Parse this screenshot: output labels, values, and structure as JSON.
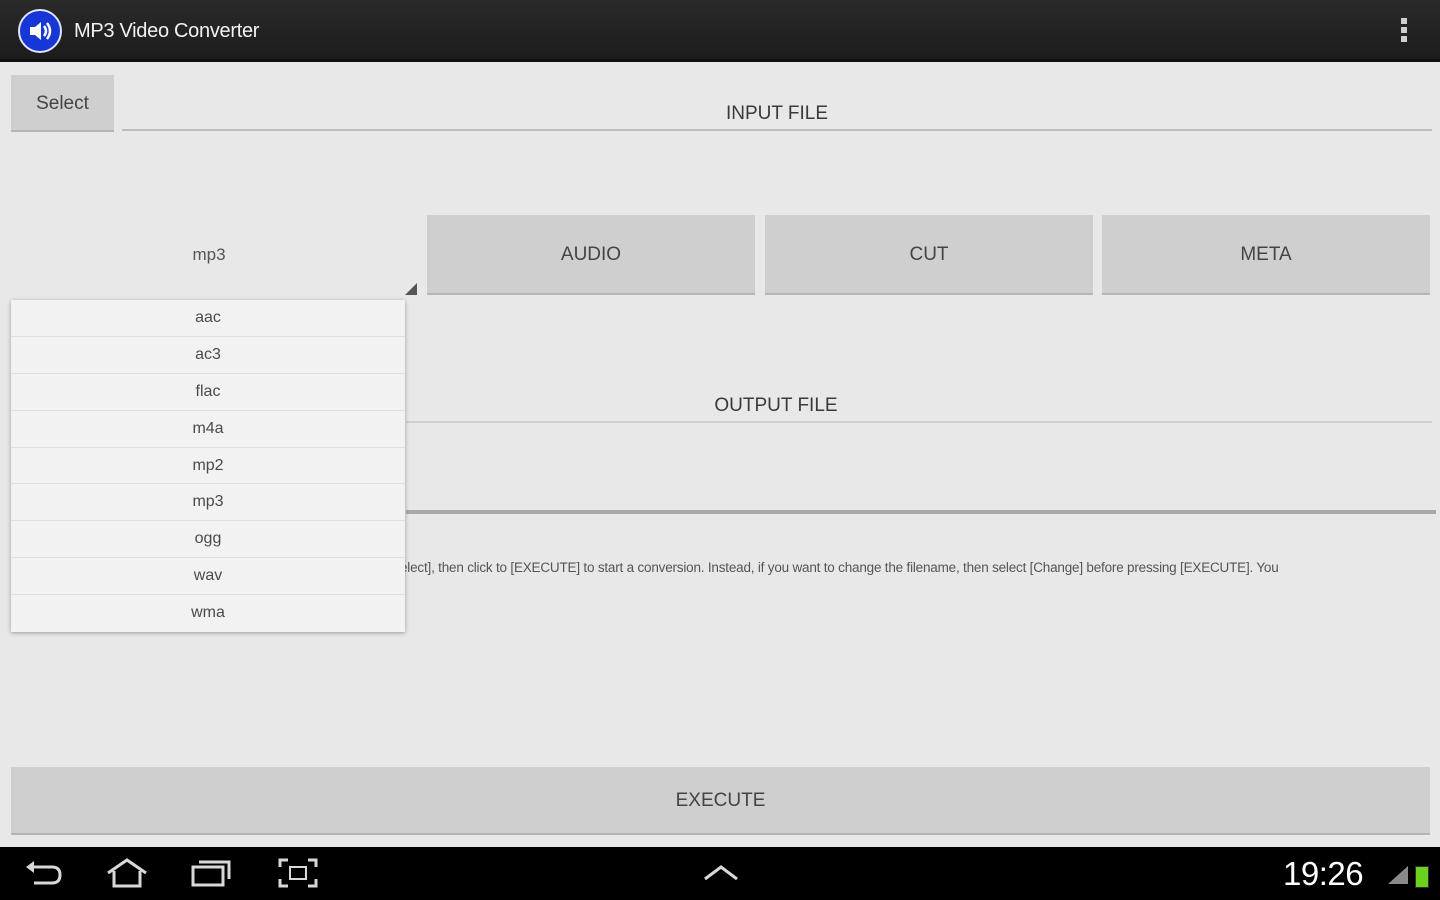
{
  "app": {
    "title": "MP3 Video Converter"
  },
  "toolbar": {
    "select_label": "Select"
  },
  "input": {
    "label": "INPUT FILE"
  },
  "format_spinner": {
    "selected": "mp3"
  },
  "tabs": {
    "audio": "AUDIO",
    "cut": "CUT",
    "meta": "META"
  },
  "output": {
    "label": "OUTPUT FILE"
  },
  "help_text": "elect], then click to [EXECUTE] to start a conversion. Instead, if you want to change the filename, then select [Change] before pressing [EXECUTE]. You",
  "dropdown": {
    "options": [
      "aac",
      "ac3",
      "flac",
      "m4a",
      "mp2",
      "mp3",
      "ogg",
      "wav",
      "wma"
    ]
  },
  "execute_label": "EXECUTE",
  "status_bar": {
    "time": "19:26"
  },
  "icons": {
    "app": "speaker-icon",
    "overflow": "overflow-menu-icon",
    "back": "back-icon",
    "home": "home-icon",
    "recent": "recent-apps-icon",
    "screenshot": "screenshot-icon",
    "up": "chevron-up-icon",
    "signal": "signal-icon",
    "battery": "battery-icon"
  },
  "colors": {
    "accent": "#1736d6",
    "battery": "#6bd11d"
  }
}
